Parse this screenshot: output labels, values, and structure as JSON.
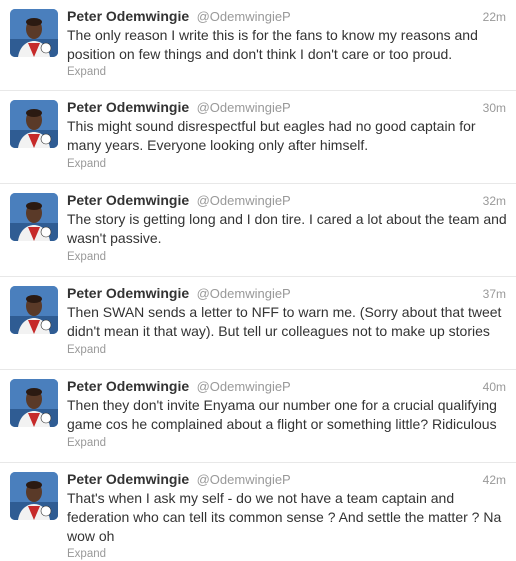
{
  "tweets": [
    {
      "name": "Peter Odemwingie",
      "handle": "@OdemwingieP",
      "time": "22m",
      "text": "The only reason I write this is for the fans to know my reasons and position on few things and don't think I don't care or too proud.",
      "expand": "Expand"
    },
    {
      "name": "Peter Odemwingie",
      "handle": "@OdemwingieP",
      "time": "30m",
      "text": "This might sound disrespectful but eagles had no good captain for many years. Everyone looking only after himself.",
      "expand": "Expand"
    },
    {
      "name": "Peter Odemwingie",
      "handle": "@OdemwingieP",
      "time": "32m",
      "text": "The story is getting long and I don tire. I cared a lot about the team and wasn't passive.",
      "expand": "Expand"
    },
    {
      "name": "Peter Odemwingie",
      "handle": "@OdemwingieP",
      "time": "37m",
      "text": "Then SWAN sends a letter to NFF to warn me. (Sorry about that tweet didn't mean it that way). But tell ur colleagues not to make up stories",
      "expand": "Expand"
    },
    {
      "name": "Peter Odemwingie",
      "handle": "@OdemwingieP",
      "time": "40m",
      "text": "Then they don't invite Enyama our number one for a crucial qualifying game cos he complained about a flight or something little? Ridiculous",
      "expand": "Expand"
    },
    {
      "name": "Peter Odemwingie",
      "handle": "@OdemwingieP",
      "time": "42m",
      "text": "That's when I ask my self - do we not have a team captain and federation who can tell its common sense ? And settle the matter ? Na wow oh",
      "expand": "Expand"
    }
  ]
}
